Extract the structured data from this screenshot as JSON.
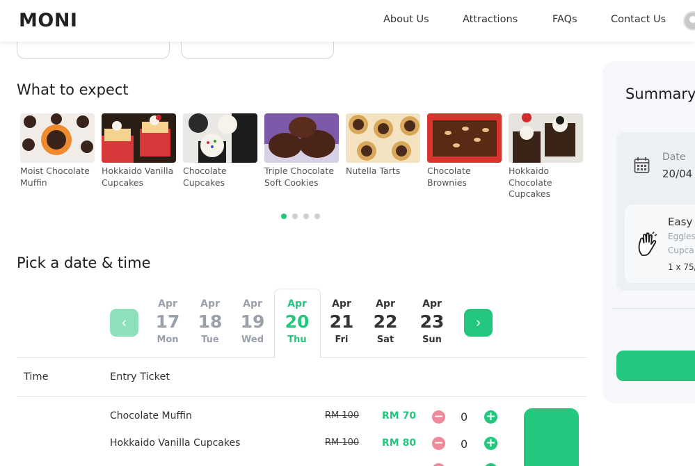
{
  "header": {
    "logo": "MONI",
    "nav": [
      "About Us",
      "Attractions",
      "FAQs",
      "Contact Us"
    ]
  },
  "sections": {
    "expect_title": "What to expect",
    "pick_title": "Pick a date & time"
  },
  "carousel": {
    "items": [
      {
        "label": "Moist Chocolate Muffin",
        "icon": "muffin-photo"
      },
      {
        "label": "Hokkaido Vanilla Cupcakes",
        "icon": "cupcake-photo"
      },
      {
        "label": "Chocolate Cupcakes",
        "icon": "cupcake-photo"
      },
      {
        "label": "Triple Chocolate Soft Cookies",
        "icon": "cookie-photo"
      },
      {
        "label": "Nutella Tarts",
        "icon": "tart-photo"
      },
      {
        "label": "Chocolate Brownies",
        "icon": "brownie-photo"
      },
      {
        "label": "Hokkaido Chocolate Cupcakes",
        "icon": "cupcake-photo"
      }
    ],
    "pages": 4,
    "active_page": 1
  },
  "date_picker": {
    "prev_icon": "‹",
    "next_icon": "›",
    "days": [
      {
        "month": "Apr",
        "day": "17",
        "weekday": "Mon",
        "state": "past"
      },
      {
        "month": "Apr",
        "day": "18",
        "weekday": "Tue",
        "state": "past"
      },
      {
        "month": "Apr",
        "day": "19",
        "weekday": "Wed",
        "state": "past"
      },
      {
        "month": "Apr",
        "day": "20",
        "weekday": "Thu",
        "state": "selected"
      },
      {
        "month": "Apr",
        "day": "21",
        "weekday": "Fri",
        "state": "future"
      },
      {
        "month": "Apr",
        "day": "22",
        "weekday": "Sat",
        "state": "future"
      },
      {
        "month": "Apr",
        "day": "23",
        "weekday": "Sun",
        "state": "future"
      }
    ]
  },
  "table": {
    "col_time": "Time",
    "col_entry": "Entry Ticket",
    "rows": [
      {
        "name": "Chocolate Muffin",
        "old_price": "RM 100",
        "new_price": "RM 70",
        "qty": "0"
      },
      {
        "name": "Hokkaido Vanilla Cupcakes",
        "old_price": "RM 100",
        "new_price": "RM 80",
        "qty": "0"
      }
    ]
  },
  "summary": {
    "title": "Summary",
    "date_label": "Date",
    "date_value": "20/04",
    "item_title": "Easy",
    "item_sub1": "Eggles",
    "item_sub2": "Cupca",
    "item_qty": "1 x 75/"
  },
  "colors": {
    "accent": "#23c77e",
    "accent_light": "#8ee0bb",
    "minus": "#ee8a9a",
    "panel": "#f5f7fa"
  }
}
